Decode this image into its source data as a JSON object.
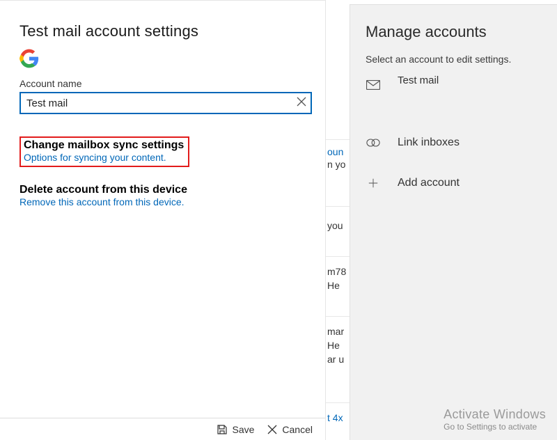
{
  "dialog": {
    "title": "Test mail account settings",
    "account_name_label": "Account name",
    "account_name_value": "Test mail",
    "change_sync_title": "Change mailbox sync settings",
    "change_sync_desc": "Options for syncing your content.",
    "delete_title": "Delete account from this device",
    "delete_desc": "Remove this account from this device.",
    "save_label": "Save",
    "cancel_label": "Cancel"
  },
  "mid": {
    "l1a": "oun",
    "l1b": "n yo",
    "l2": " you",
    "l3a": "m78",
    "l3b": " He",
    "l4a": "mar",
    "l4b": " He",
    "l4c": "ar u",
    "l5": "t 4x"
  },
  "right": {
    "title": "Manage accounts",
    "subtitle": "Select an account to edit settings.",
    "account_label": "Test mail",
    "link_inboxes": "Link inboxes",
    "add_account": "Add account"
  },
  "watermark": {
    "line1": "Activate Windows",
    "line2": "Go to Settings to activate"
  }
}
